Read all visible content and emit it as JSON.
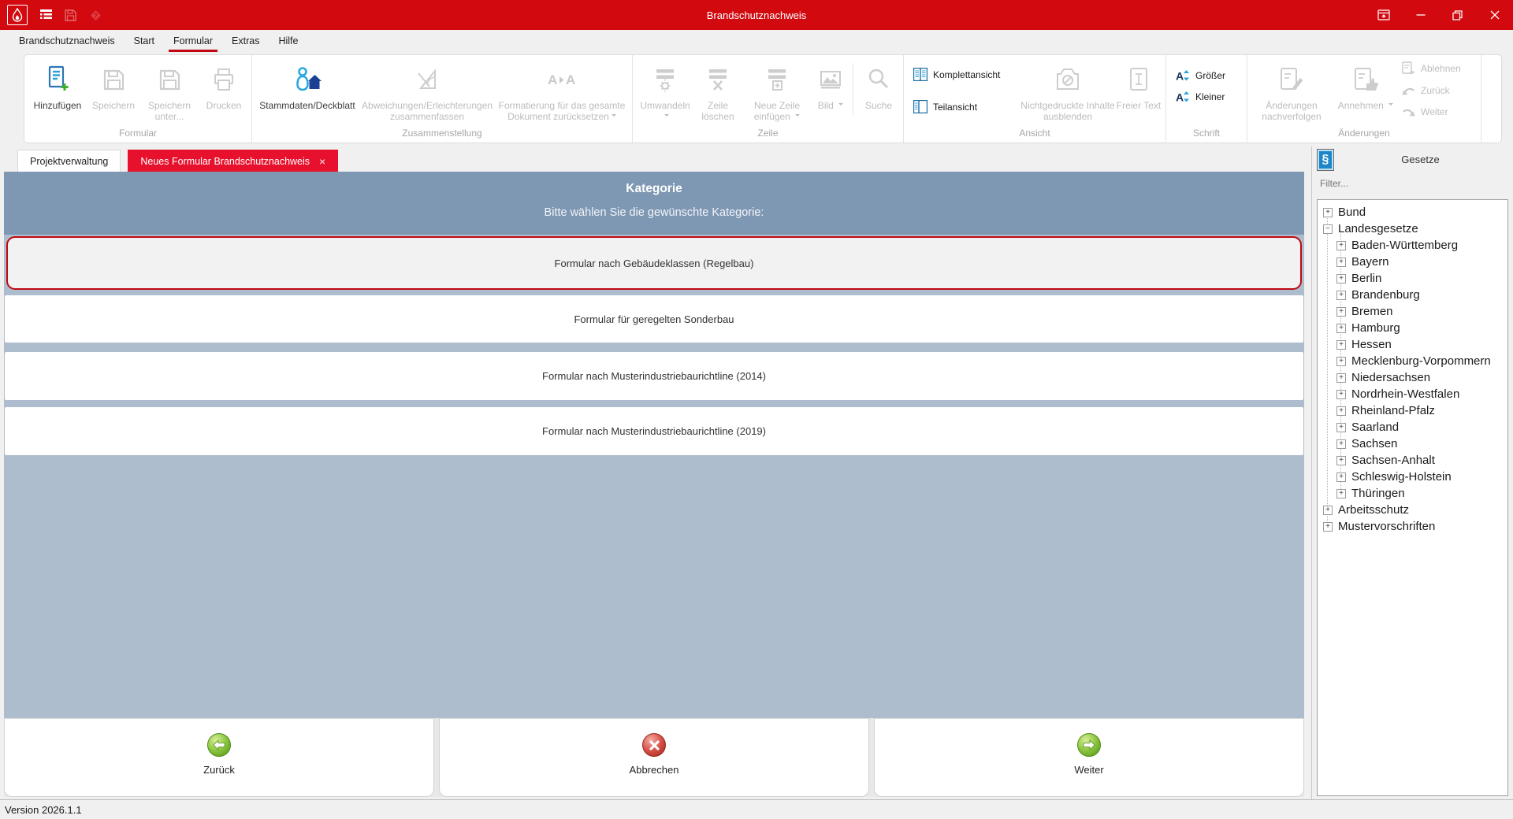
{
  "colors": {
    "titlebar_red": "#d20a10",
    "tab_red": "#e8112d",
    "header_blue": "#7e97b3",
    "panel_blue": "#aebdcd",
    "selected_border_red": "#c00812",
    "accent_blue": "#1c6ea4"
  },
  "glyphs": {
    "close": "×",
    "paragraph": "§"
  },
  "titlebar": {
    "title": "Brandschutznachweis"
  },
  "menu": {
    "items": [
      "Brandschutznachweis",
      "Start",
      "Formular",
      "Extras",
      "Hilfe"
    ],
    "active": "Formular"
  },
  "ribbon": {
    "groups": [
      {
        "label": "Formular",
        "buttons": [
          {
            "label": "Hinzufügen",
            "enabled": true
          },
          {
            "label": "Speichern",
            "enabled": false
          },
          {
            "label": "Speichern unter...",
            "enabled": false
          },
          {
            "label": "Drucken",
            "enabled": false
          }
        ]
      },
      {
        "label": "Zusammenstellung",
        "buttons": [
          {
            "label": "Stammdaten/Deckblatt",
            "enabled": true
          },
          {
            "label": "Abweichungen/Erleichterungen zusammenfassen",
            "enabled": false
          },
          {
            "label": "Formatierung für das gesamte Dokument zurücksetzen",
            "enabled": false,
            "dropdown": true
          }
        ]
      },
      {
        "label": "Zeile",
        "buttons": [
          {
            "label": "Umwandeln",
            "enabled": false,
            "dropdown": true
          },
          {
            "label": "Zeile löschen",
            "enabled": false
          },
          {
            "label": "Neue Zeile einfügen",
            "enabled": false,
            "dropdown": true
          },
          {
            "label": "Bild",
            "enabled": false,
            "dropdown": true
          },
          {
            "label": "Suche",
            "enabled": false
          }
        ]
      },
      {
        "label": "Ansicht",
        "buttons": [
          {
            "label": "Komplettansicht",
            "enabled": true
          },
          {
            "label": "Teilansicht",
            "enabled": true
          },
          {
            "label": "Nichtgedruckte Inhalte ausblenden",
            "enabled": false
          },
          {
            "label": "Freier Text",
            "enabled": false
          }
        ]
      },
      {
        "label": "Schrift",
        "buttons": [
          {
            "label": "Größer",
            "enabled": true
          },
          {
            "label": "Kleiner",
            "enabled": true
          }
        ]
      },
      {
        "label": "Änderungen",
        "buttons": [
          {
            "label": "Änderungen nachverfolgen",
            "enabled": false
          },
          {
            "label": "Annehmen",
            "enabled": false,
            "dropdown": true
          },
          {
            "label": "Ablehnen",
            "enabled": false
          },
          {
            "label": "Zurück",
            "enabled": false
          },
          {
            "label": "Weiter",
            "enabled": false
          }
        ]
      }
    ]
  },
  "tabs": {
    "items": [
      {
        "label": "Projektverwaltung",
        "active": false
      },
      {
        "label": "Neues Formular Brandschutznachweis",
        "active": true,
        "closable": true
      }
    ]
  },
  "main": {
    "header": {
      "title": "Kategorie",
      "subtitle": "Bitte wählen Sie die gewünschte Kategorie:"
    },
    "options": [
      {
        "label": "Formular nach Gebäudeklassen (Regelbau)",
        "selected": true
      },
      {
        "label": "Formular für geregelten Sonderbau",
        "selected": false
      },
      {
        "label": "Formular nach Musterindustriebaurichtline (2014)",
        "selected": false
      },
      {
        "label": "Formular nach Musterindustriebaurichtline (2019)",
        "selected": false
      }
    ],
    "footer": [
      {
        "label": "Zurück",
        "icon": "arrow-left-green"
      },
      {
        "label": "Abbrechen",
        "icon": "cancel-red"
      },
      {
        "label": "Weiter",
        "icon": "arrow-right-green"
      }
    ]
  },
  "sidebar": {
    "title": "Gesetze",
    "filter_placeholder": "Filter...",
    "tree": [
      {
        "label": "Bund",
        "depth": 0,
        "sign": "+"
      },
      {
        "label": "Landesgesetze",
        "depth": 0,
        "sign": "−"
      },
      {
        "label": "Baden-Württemberg",
        "depth": 1,
        "sign": "+"
      },
      {
        "label": "Bayern",
        "depth": 1,
        "sign": "+"
      },
      {
        "label": "Berlin",
        "depth": 1,
        "sign": "+"
      },
      {
        "label": "Brandenburg",
        "depth": 1,
        "sign": "+"
      },
      {
        "label": "Bremen",
        "depth": 1,
        "sign": "+"
      },
      {
        "label": "Hamburg",
        "depth": 1,
        "sign": "+"
      },
      {
        "label": "Hessen",
        "depth": 1,
        "sign": "+"
      },
      {
        "label": "Mecklenburg-Vorpommern",
        "depth": 1,
        "sign": "+"
      },
      {
        "label": "Niedersachsen",
        "depth": 1,
        "sign": "+"
      },
      {
        "label": "Nordrhein-Westfalen",
        "depth": 1,
        "sign": "+"
      },
      {
        "label": "Rheinland-Pfalz",
        "depth": 1,
        "sign": "+"
      },
      {
        "label": "Saarland",
        "depth": 1,
        "sign": "+"
      },
      {
        "label": "Sachsen",
        "depth": 1,
        "sign": "+"
      },
      {
        "label": "Sachsen-Anhalt",
        "depth": 1,
        "sign": "+"
      },
      {
        "label": "Schleswig-Holstein",
        "depth": 1,
        "sign": "+"
      },
      {
        "label": "Thüringen",
        "depth": 1,
        "sign": "+"
      },
      {
        "label": "Arbeitsschutz",
        "depth": 0,
        "sign": "+"
      },
      {
        "label": "Mustervorschriften",
        "depth": 0,
        "sign": "+"
      }
    ]
  },
  "statusbar": {
    "version": "Version 2026.1.1"
  }
}
